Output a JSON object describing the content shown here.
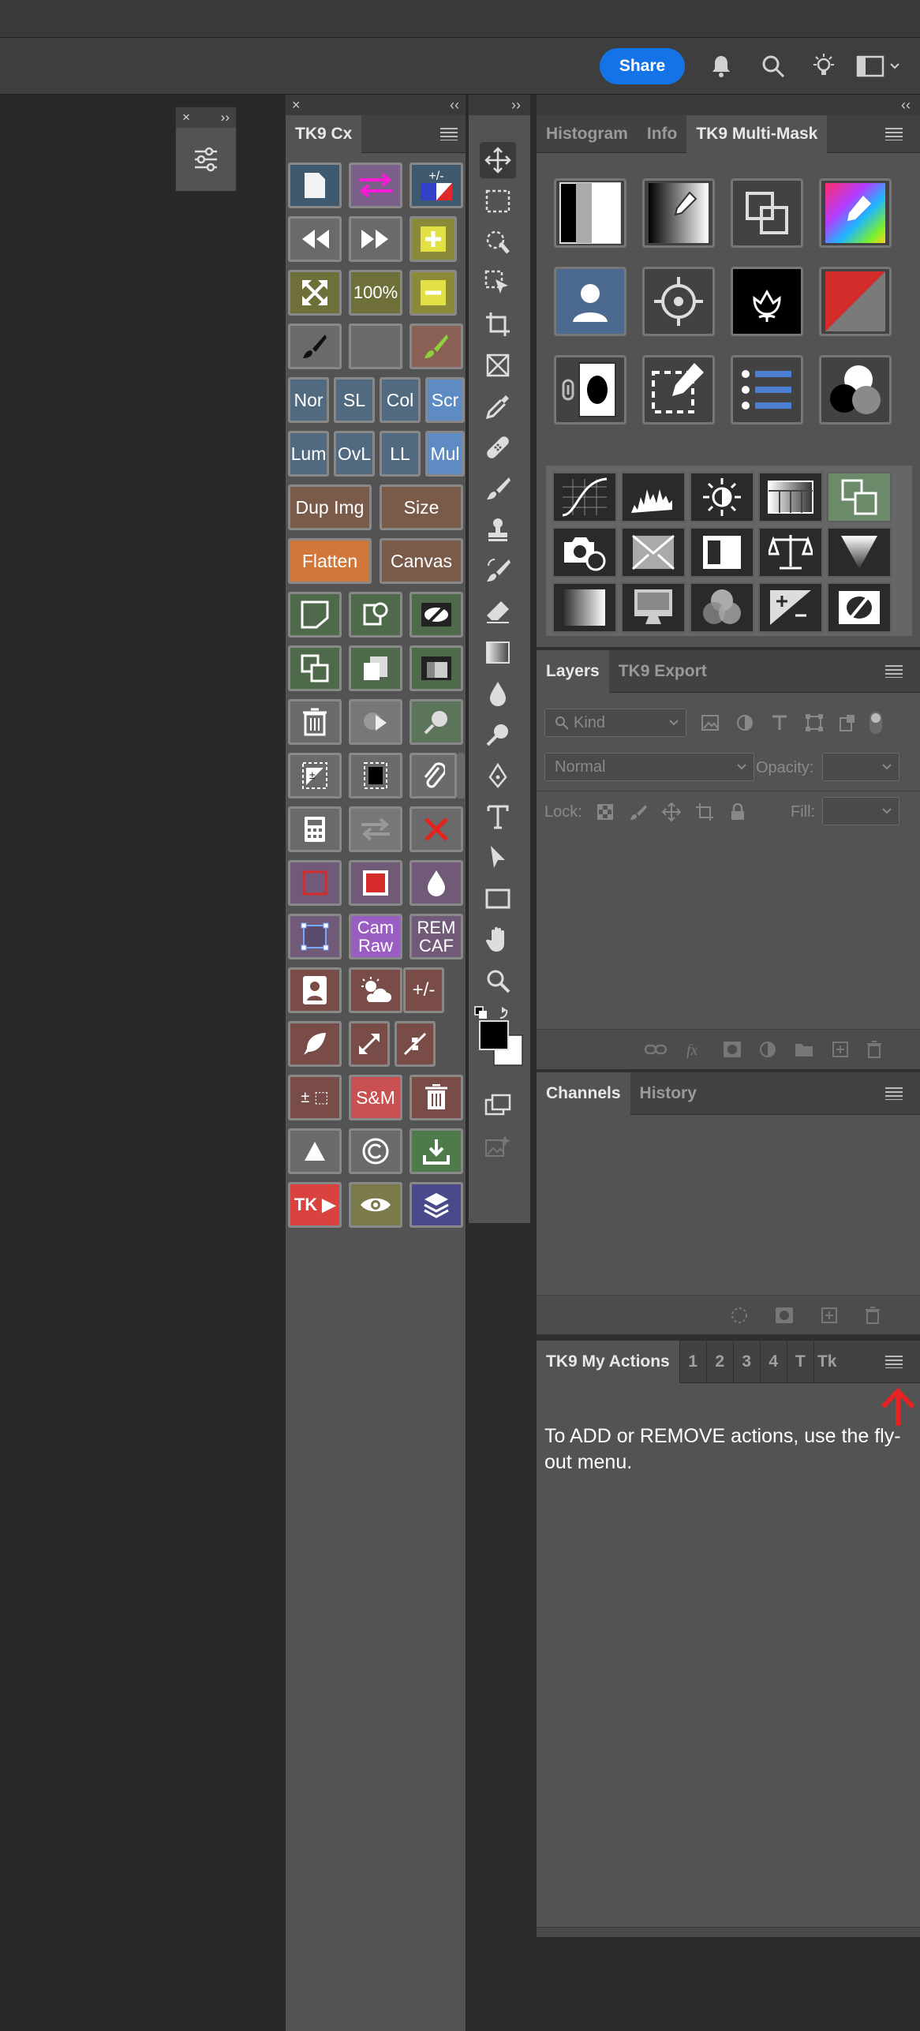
{
  "topbar": {
    "share_label": "Share"
  },
  "mini_panel": {
    "close": "×",
    "expand": "››"
  },
  "tk9cx": {
    "close": "×",
    "collapse": "‹‹",
    "tab": "TK9 Cx",
    "labels": {
      "plusminus": "+/-",
      "hundred": "100%",
      "nor": "Nor",
      "sl": "SL",
      "col": "Col",
      "scr": "Scr",
      "lum": "Lum",
      "ovl": "OvL",
      "ll": "LL",
      "mul": "Mul",
      "dup": "Dup Img",
      "size": "Size",
      "flatten": "Flatten",
      "canvas": "Canvas",
      "cam": "Cam Raw",
      "rem": "REM CAF",
      "pm2": "+/-",
      "pmsel": "± ⬚",
      "sm": "S&M",
      "tk": "TK ▶"
    }
  },
  "toolbar": {
    "expand": "››"
  },
  "dock": {
    "collapse": "‹‹",
    "tabs1": [
      "Histogram",
      "Info",
      "TK9 Multi-Mask"
    ],
    "layers_tabs": [
      "Layers",
      "TK9 Export"
    ],
    "kind_placeholder": "Kind",
    "blend_mode": "Normal",
    "opacity_label": "Opacity:",
    "lock_label": "Lock:",
    "fill_label": "Fill:",
    "channels_tabs": [
      "Channels",
      "History"
    ],
    "actions_tab": "TK9 My Actions",
    "actions_num_tabs": [
      "1",
      "2",
      "3",
      "4",
      "T",
      "Tk"
    ],
    "actions_message": "To ADD or REMOVE actions, use the fly-out menu."
  },
  "colors": {
    "accent": "#1473e6",
    "arrow": "#e62222"
  }
}
